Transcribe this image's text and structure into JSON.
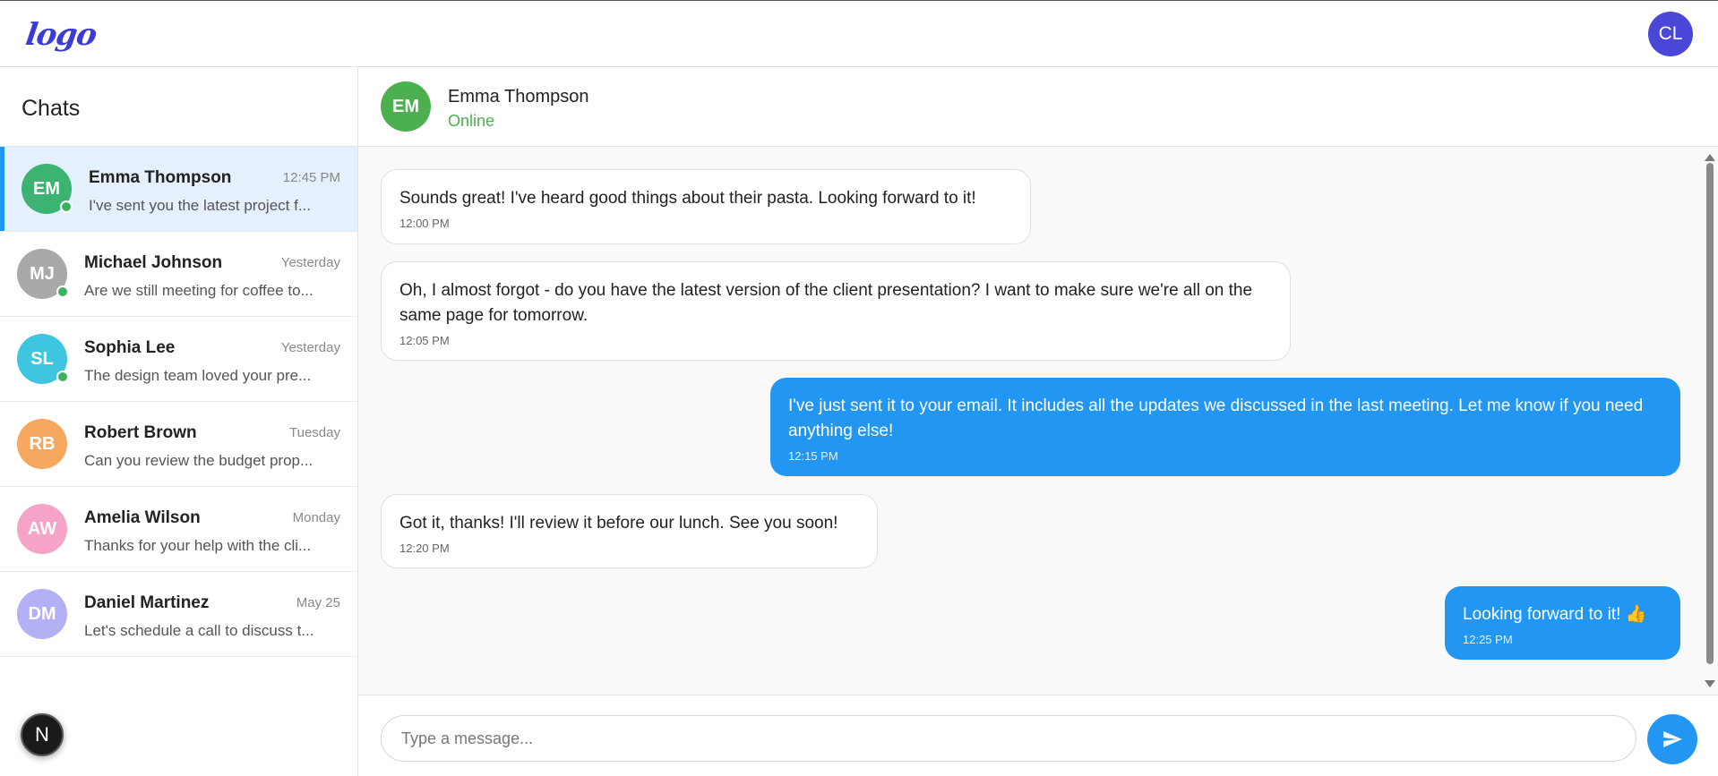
{
  "app": {
    "logo_text": "logo",
    "user_initials": "CL"
  },
  "sidebar": {
    "title": "Chats",
    "chats": [
      {
        "initials": "EM",
        "name": "Emma Thompson",
        "time": "12:45 PM",
        "preview": "I've sent you the latest project f...",
        "color": "#3cb371",
        "online": true,
        "active": true
      },
      {
        "initials": "MJ",
        "name": "Michael Johnson",
        "time": "Yesterday",
        "preview": "Are we still meeting for coffee to...",
        "color": "#a9a9a9",
        "online": true,
        "active": false
      },
      {
        "initials": "SL",
        "name": "Sophia Lee",
        "time": "Yesterday",
        "preview": "The design team loved your pre...",
        "color": "#3ec6e0",
        "online": true,
        "active": false
      },
      {
        "initials": "RB",
        "name": "Robert Brown",
        "time": "Tuesday",
        "preview": "Can you review the budget prop...",
        "color": "#f6a85e",
        "online": false,
        "active": false
      },
      {
        "initials": "AW",
        "name": "Amelia Wilson",
        "time": "Monday",
        "preview": "Thanks for your help with the cli...",
        "color": "#f5a3c7",
        "online": false,
        "active": false
      },
      {
        "initials": "DM",
        "name": "Daniel Martinez",
        "time": "May 25",
        "preview": "Let's schedule a call to discuss t...",
        "color": "#b3b0f5",
        "online": false,
        "active": false
      }
    ],
    "badge_letter": "N"
  },
  "conversation": {
    "contact_initials": "EM",
    "contact_name": "Emma Thompson",
    "contact_status": "Online",
    "messages": [
      {
        "direction": "in",
        "text": "Sounds great! I've heard good things about their pasta. Looking forward to it!",
        "time": "12:00 PM"
      },
      {
        "direction": "in",
        "text": "Oh, I almost forgot - do you have the latest version of the client presentation? I want to make sure we're all on the same page for tomorrow.",
        "time": "12:05 PM"
      },
      {
        "direction": "out",
        "text": "I've just sent it to your email. It includes all the updates we discussed in the last meeting. Let me know if you need anything else!",
        "time": "12:15 PM"
      },
      {
        "direction": "in",
        "text": "Got it, thanks! I'll review it before our lunch. See you soon!",
        "time": "12:20 PM"
      },
      {
        "direction": "out",
        "text": "Looking forward to it! 👍",
        "time": "12:25 PM"
      }
    ]
  },
  "composer": {
    "placeholder": "Type a message...",
    "value": ""
  },
  "colors": {
    "accent": "#2196f3",
    "online": "#4caf50",
    "logo": "#3b3bd6",
    "user_avatar": "#4a47d8"
  }
}
